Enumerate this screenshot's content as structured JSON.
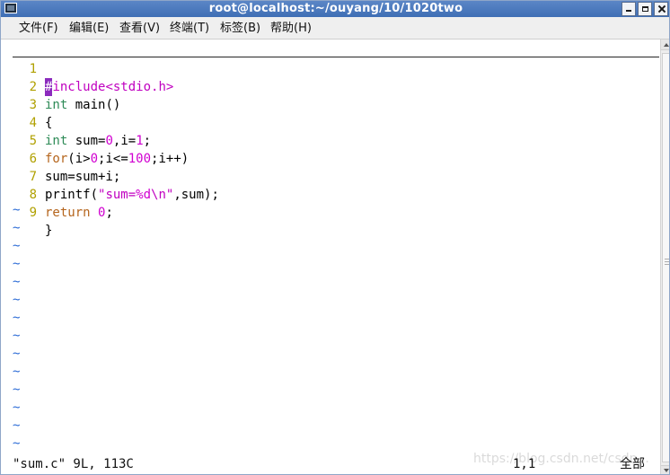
{
  "window": {
    "title": "root@localhost:~/ouyang/10/1020two",
    "buttons": {
      "minimize_icon": "minimize-icon",
      "maximize_icon": "maximize-icon",
      "close_icon": "close-icon"
    }
  },
  "menubar": {
    "items": [
      {
        "id": "file",
        "label": "文件(F)"
      },
      {
        "id": "edit",
        "label": "编辑(E)"
      },
      {
        "id": "view",
        "label": "查看(V)"
      },
      {
        "id": "terminal",
        "label": "终端(T)"
      },
      {
        "id": "tabs",
        "label": "标签(B)"
      },
      {
        "id": "help",
        "label": "帮助(H)"
      }
    ]
  },
  "editor": {
    "lines": [
      {
        "n": "1",
        "text": "#include<stdio.h>"
      },
      {
        "n": "2",
        "text": "int main()"
      },
      {
        "n": "3",
        "text": "{"
      },
      {
        "n": "4",
        "text": "int sum=0,i=1;"
      },
      {
        "n": "5",
        "text": "for(i>0;i<=100;i++)"
      },
      {
        "n": "6",
        "text": "sum=sum+i;"
      },
      {
        "n": "7",
        "text": "printf(\"sum=%d\\n\",sum);"
      },
      {
        "n": "8",
        "text": "return 0;"
      },
      {
        "n": "9",
        "text": "}"
      }
    ],
    "tilde": "~",
    "status_left": "\"sum.c\" 9L, 113C",
    "status_position": "1,1",
    "status_scope": "全部"
  },
  "overlay": {
    "watermark": "https://blog.csdn.net/csdn..."
  },
  "colors": {
    "titlebar_blue": "#3f6fb5",
    "line_numbers": "#b0a000",
    "tilde_blue": "#2b6bd6",
    "keyword_green": "#2e8b57",
    "control_orange": "#b5651d",
    "preprocessor_magenta": "#c000c0",
    "number_magenta": "#d000d0",
    "cursor_purple": "#8b2bbd"
  }
}
